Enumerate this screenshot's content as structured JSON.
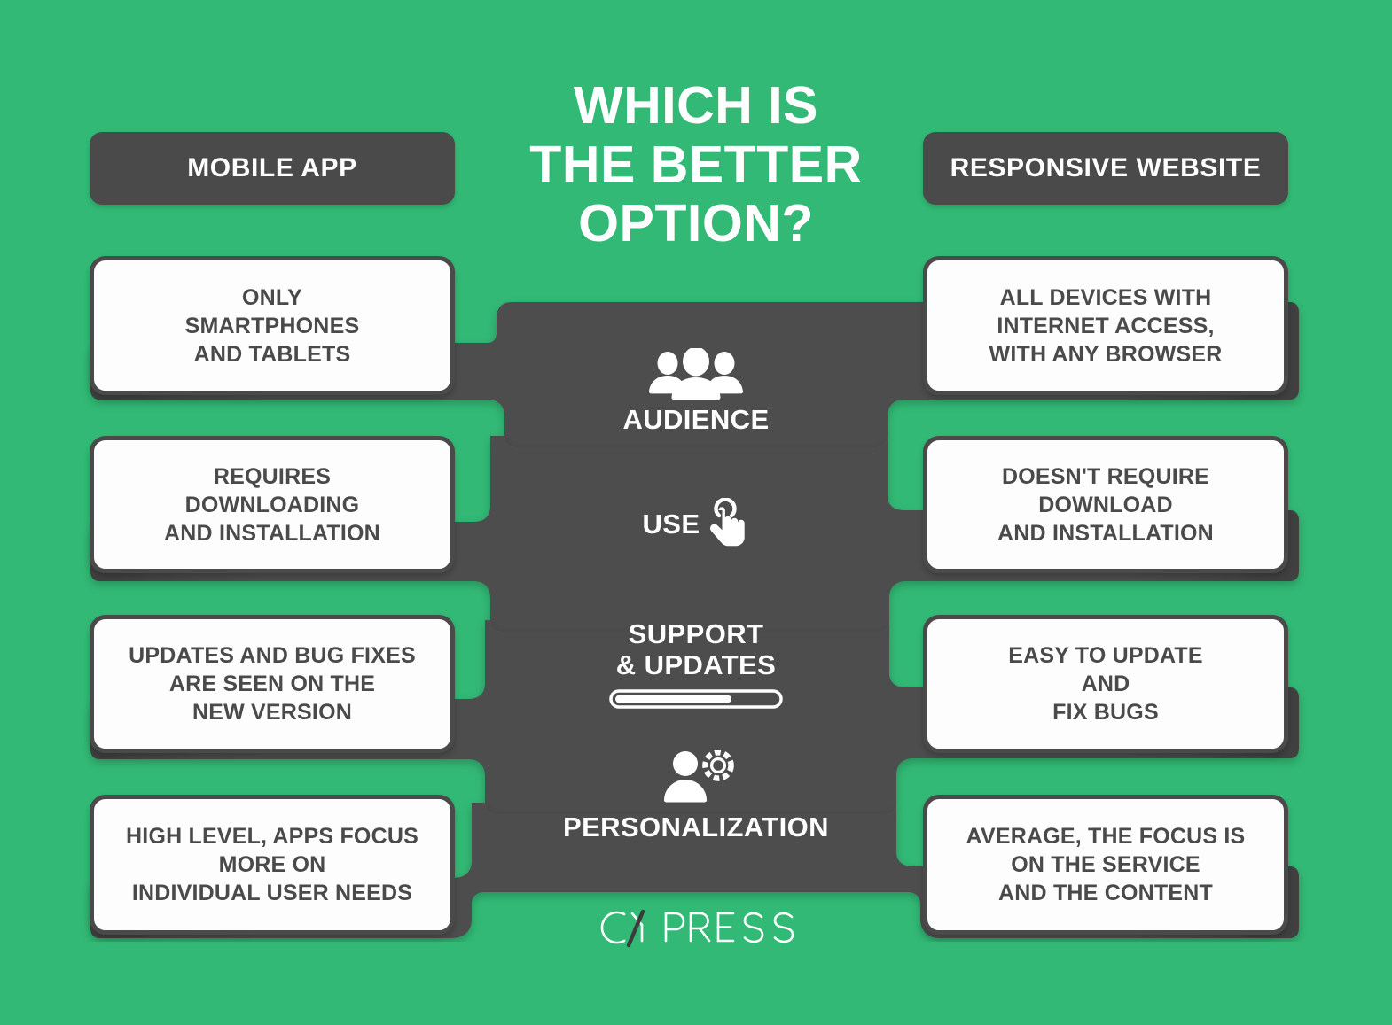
{
  "theme": {
    "background": "#32b975",
    "ribbon": "#4a4a4a",
    "card_bg": "#fdfdfd",
    "card_border": "#4a4a4a",
    "text_dark": "#4a4a4a",
    "text_light": "#ffffff"
  },
  "title": "WHICH IS\nTHE BETTER\nOPTION?",
  "headers": {
    "left": "MOBILE APP",
    "right": "RESPONSIVE WEBSITE"
  },
  "rows": [
    {
      "feature": "AUDIENCE",
      "icon": "people-group-icon",
      "left": "ONLY\nSMARTPHONES\nAND TABLETS",
      "right": "ALL DEVICES WITH\nINTERNET ACCESS,\nWITH ANY BROWSER"
    },
    {
      "feature": "USE",
      "icon": "tap-hand-icon",
      "left": "REQUIRES\nDOWNLOADING\nAND INSTALLATION",
      "right": "DOESN'T REQUIRE\nDOWNLOAD\nAND INSTALLATION"
    },
    {
      "feature": "SUPPORT\n& UPDATES",
      "icon": "progress-bar-icon",
      "progress_percent": 72,
      "left": "UPDATES AND BUG FIXES\nARE SEEN ON THE\nNEW VERSION",
      "right": "EASY TO UPDATE\nAND\nFIX BUGS"
    },
    {
      "feature": "PERSONALIZATION",
      "icon": "person-gear-icon",
      "left": "HIGH LEVEL, APPS FOCUS\nMORE ON\nINDIVIDUAL USER NEEDS",
      "right": "AVERAGE, THE FOCUS IS\nON THE SERVICE\nAND THE CONTENT"
    }
  ],
  "logo": {
    "text_before": "C",
    "text_after": "PRESS",
    "full": "CYPRESS"
  }
}
